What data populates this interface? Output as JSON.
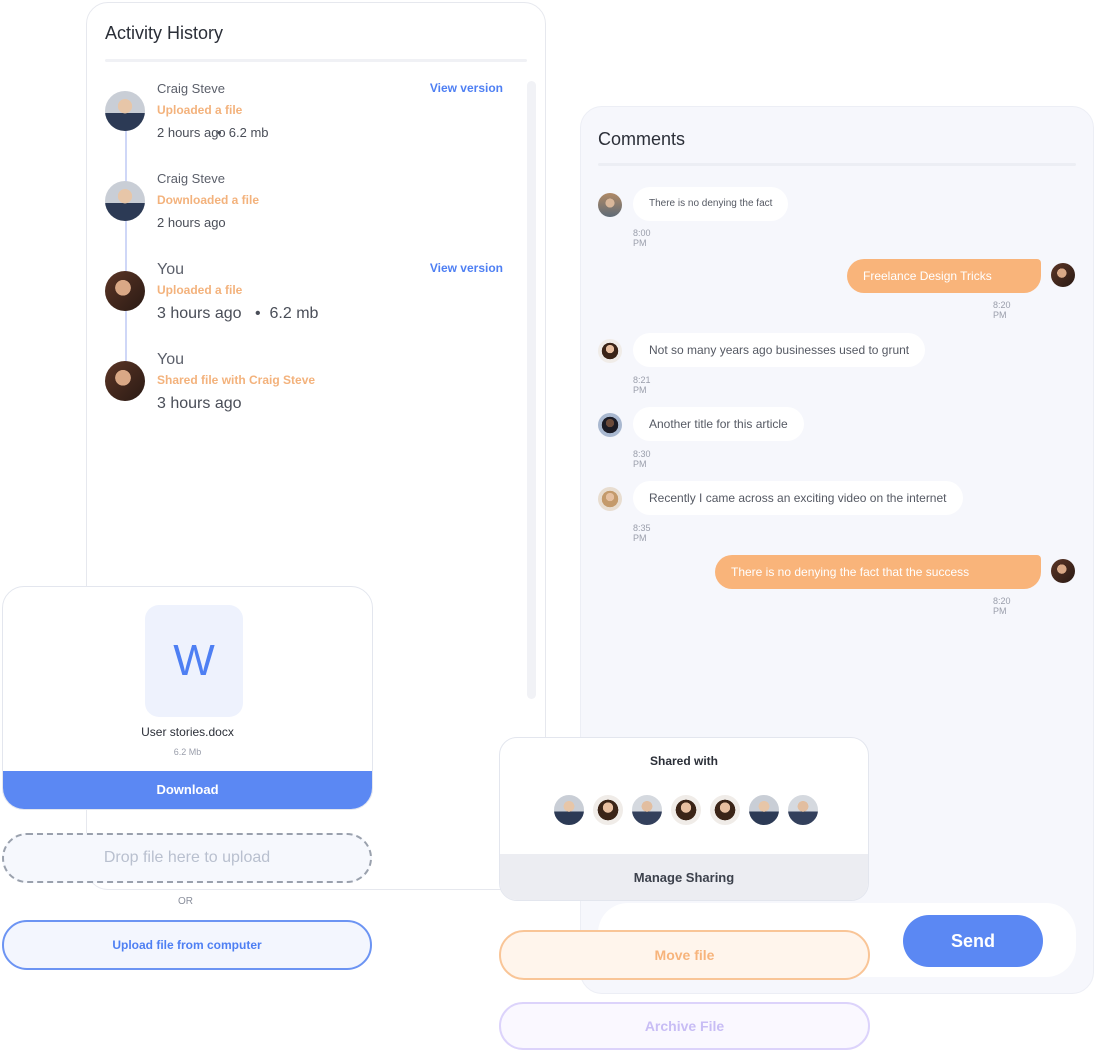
{
  "activity": {
    "title": "Activity History",
    "items": [
      {
        "who": "Craig Steve",
        "action": "Uploaded a file",
        "time": "2 hours ago",
        "size": "6.2 mb",
        "link": "View version"
      },
      {
        "who": "Craig Steve",
        "action": "Downloaded a file",
        "time": "2 hours ago",
        "size": "",
        "link": ""
      },
      {
        "who": "You",
        "action": "Uploaded a file",
        "time": "3 hours ago",
        "size": "6.2 mb",
        "link": "View version"
      },
      {
        "who": "You",
        "action": "Shared file with Craig Steve",
        "time": "3 hours ago",
        "size": "",
        "link": ""
      }
    ]
  },
  "comments": {
    "title": "Comments",
    "messages": [
      {
        "text": "There is no denying the fact",
        "time": "8:00 PM",
        "side": "in"
      },
      {
        "text": "Freelance Design Tricks",
        "time": "8:20 PM",
        "side": "out"
      },
      {
        "text": "Not so many years ago businesses used to grunt",
        "time": "8:21 PM",
        "side": "in"
      },
      {
        "text": "Another title for this article",
        "time": "8:30 PM",
        "side": "in"
      },
      {
        "text": "Recently I came across an exciting video on the internet",
        "time": "8:35 PM",
        "side": "in"
      },
      {
        "text": "There is no denying the fact that the success",
        "time": "8:20 PM",
        "side": "out"
      }
    ],
    "send_label": "Send"
  },
  "document": {
    "icon_letter": "W",
    "file_name": "User stories.docx",
    "file_size": "6.2 Mb",
    "download_label": "Download"
  },
  "upload": {
    "dropzone_text": "Drop file here to upload",
    "or_text": "OR",
    "upload_button": "Upload file from computer"
  },
  "shared": {
    "title": "Shared with",
    "manage_label": "Manage Sharing"
  },
  "actions": {
    "move_label": "Move file",
    "archive_label": "Archive File"
  },
  "colors": {
    "accent_blue": "#5b88f3",
    "accent_orange": "#f9b47a",
    "accent_purple": "#c8bdf5"
  }
}
